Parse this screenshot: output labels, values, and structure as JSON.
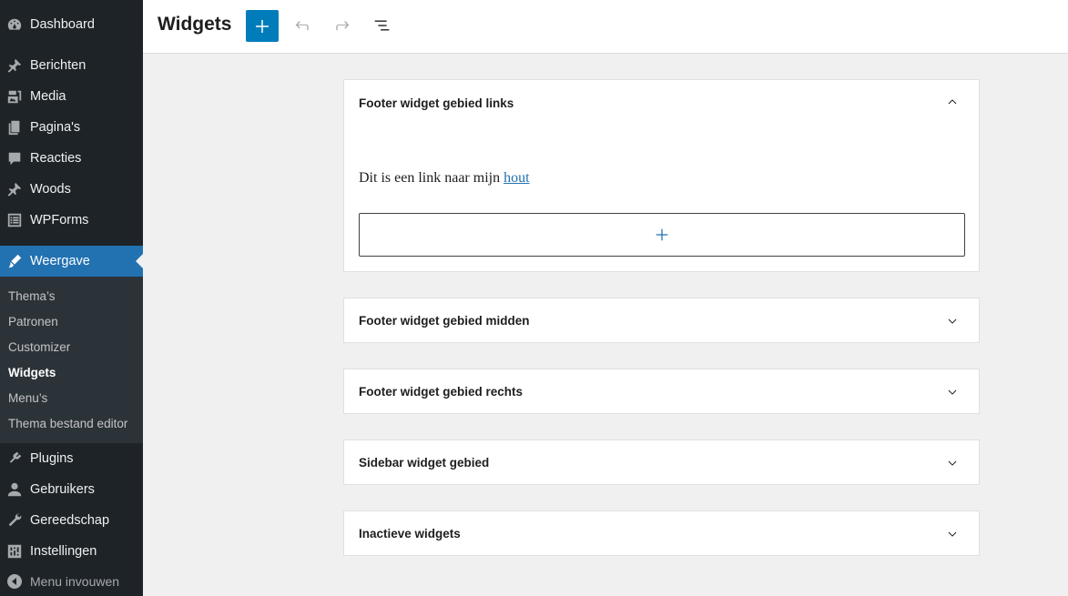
{
  "sidebar": {
    "items": [
      {
        "label": "Dashboard",
        "icon": "dashboard-icon"
      },
      {
        "label": "Berichten",
        "icon": "pin-icon"
      },
      {
        "label": "Media",
        "icon": "media-icon"
      },
      {
        "label": "Pagina's",
        "icon": "pages-icon"
      },
      {
        "label": "Reacties",
        "icon": "comments-icon"
      },
      {
        "label": "Woods",
        "icon": "pin-icon"
      },
      {
        "label": "WPForms",
        "icon": "forms-icon"
      },
      {
        "label": "Weergave",
        "icon": "appearance-icon"
      },
      {
        "label": "Plugins",
        "icon": "plugins-icon"
      },
      {
        "label": "Gebruikers",
        "icon": "users-icon"
      },
      {
        "label": "Gereedschap",
        "icon": "tools-icon"
      },
      {
        "label": "Instellingen",
        "icon": "settings-icon"
      }
    ],
    "submenu": [
      "Thema’s",
      "Patronen",
      "Customizer",
      "Widgets",
      "Menu’s",
      "Thema bestand editor"
    ],
    "collapse_label": "Menu invouwen"
  },
  "header": {
    "title": "Widgets"
  },
  "areas": [
    {
      "title": "Footer widget gebied links",
      "expanded": true
    },
    {
      "title": "Footer widget gebied midden",
      "expanded": false
    },
    {
      "title": "Footer widget gebied rechts",
      "expanded": false
    },
    {
      "title": "Sidebar widget gebied",
      "expanded": false
    },
    {
      "title": "Inactieve widgets",
      "expanded": false
    }
  ],
  "paragraph": {
    "text": "Dit is een link naar mijn ",
    "link_text": "hout"
  },
  "colors": {
    "sidebar_bg": "#1d2327",
    "accent": "#2271b1",
    "add_button": "#007cba"
  }
}
